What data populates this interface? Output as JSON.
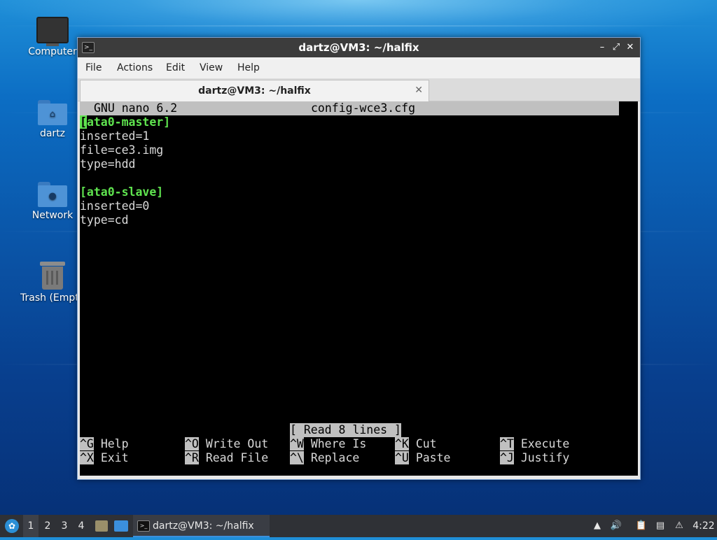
{
  "desktop": {
    "icons": [
      {
        "label": "Computer",
        "icon": "monitor-icon"
      },
      {
        "label": "dartz",
        "icon": "home-folder-icon"
      },
      {
        "label": "Network",
        "icon": "network-folder-icon"
      },
      {
        "label": "Trash (Empty)",
        "icon": "trash-icon"
      }
    ]
  },
  "window": {
    "title": "dartz@VM3: ~/halfix",
    "buttons": {
      "minimize": "–",
      "maximize": "⤢",
      "close": "✕"
    },
    "menu": [
      "File",
      "Actions",
      "Edit",
      "View",
      "Help"
    ],
    "tab": {
      "label": "dartz@VM3: ~/halfix",
      "close": "✕"
    }
  },
  "nano": {
    "version": "GNU nano 6.2",
    "filename": "config-wce3.cfg",
    "lines": [
      {
        "text": "ata0-master]",
        "section": true,
        "cursor_char": "["
      },
      {
        "text": "inserted=1"
      },
      {
        "text": "file=ce3.img"
      },
      {
        "text": "type=hdd"
      },
      {
        "text": ""
      },
      {
        "text": "[ata0-slave]",
        "section": true
      },
      {
        "text": "inserted=0"
      },
      {
        "text": "type=cd"
      }
    ],
    "status": "[ Read 8 lines ]",
    "shortcuts": [
      {
        "key": "^G",
        "label": "Help"
      },
      {
        "key": "^O",
        "label": "Write Out"
      },
      {
        "key": "^W",
        "label": "Where Is"
      },
      {
        "key": "^K",
        "label": "Cut"
      },
      {
        "key": "^T",
        "label": "Execute"
      },
      {
        "key": "^X",
        "label": "Exit"
      },
      {
        "key": "^R",
        "label": "Read File"
      },
      {
        "key": "^\\",
        "label": "Replace"
      },
      {
        "key": "^U",
        "label": "Paste"
      },
      {
        "key": "^J",
        "label": "Justify"
      }
    ]
  },
  "taskbar": {
    "workspaces": [
      "1",
      "2",
      "3",
      "4"
    ],
    "active_workspace": "1",
    "task": "dartz@VM3: ~/halfix",
    "clock": "4:22"
  },
  "colors": {
    "accent": "#3b8fdc",
    "nano_highlight": "#5fe34f",
    "terminal_bg": "#000000",
    "titlebar_bg": "#3c3c3c"
  }
}
